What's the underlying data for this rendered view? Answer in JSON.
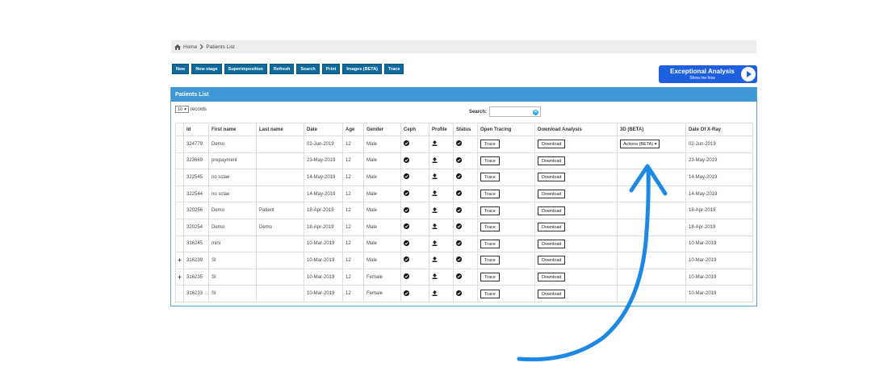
{
  "breadcrumb": {
    "home": "Home",
    "current": "Patients List"
  },
  "toolbar": [
    "New",
    "New stage",
    "Superimposition",
    "Refresh",
    "Search",
    "Print",
    "Images (BETA)",
    "Trace"
  ],
  "promo": {
    "title": "Exceptional Analysis",
    "subtitle": "Show me how"
  },
  "panel": {
    "title": "Patients List"
  },
  "controls": {
    "page_length": "10",
    "records_label": "records",
    "search_label": "Search:"
  },
  "columns": [
    "Id",
    "First name",
    "Last name",
    "Date",
    "Age",
    "Gender",
    "Ceph",
    "Profile",
    "Status",
    "Open Tracing",
    "Download Analysis",
    "3D (BETA)",
    "Date Of X-Ray"
  ],
  "buttons": {
    "trace": "Trace",
    "download": "Download",
    "actions": "Actions (BETA)"
  },
  "rows": [
    {
      "expand": "",
      "id": "324779",
      "first": "Demo",
      "last": "",
      "date": "02-Jun-2019",
      "age": "12",
      "gender": "Male",
      "xray": "02-Jun-2019"
    },
    {
      "expand": "",
      "id": "323669",
      "first": "prepayment",
      "last": "",
      "date": "23-May-2019",
      "age": "12",
      "gender": "Male",
      "xray": "23-May-2019"
    },
    {
      "expand": "",
      "id": "322545",
      "first": "no sclae",
      "last": "",
      "date": "14-May-2019",
      "age": "12",
      "gender": "Male",
      "xray": "14-May-2019"
    },
    {
      "expand": "",
      "id": "322544",
      "first": "no sclae",
      "last": "",
      "date": "14-May-2019",
      "age": "12",
      "gender": "Male",
      "xray": "14-May-2019"
    },
    {
      "expand": "",
      "id": "320256",
      "first": "Demo",
      "last": "Patient",
      "date": "18-Apr-2019",
      "age": "12",
      "gender": "Male",
      "xray": "18-Apr-2019"
    },
    {
      "expand": "",
      "id": "320254",
      "first": "Demo",
      "last": "Demo",
      "date": "18-Apr-2019",
      "age": "12",
      "gender": "Male",
      "xray": "18-Apr-2019"
    },
    {
      "expand": "",
      "id": "316245",
      "first": "mini",
      "last": "",
      "date": "10-Mar-2019",
      "age": "12",
      "gender": "Male",
      "xray": "10-Mar-2019"
    },
    {
      "expand": "+",
      "id": "316239",
      "first": "SI",
      "last": "",
      "date": "10-Mar-2019",
      "age": "12",
      "gender": "Male",
      "xray": "10-Mar-2019"
    },
    {
      "expand": "+",
      "id": "316235",
      "first": "SI",
      "last": "",
      "date": "10-Mar-2019",
      "age": "12",
      "gender": "Female",
      "xray": "10-Mar-2019"
    },
    {
      "expand": "",
      "id": "316233",
      "first": "SI",
      "last": "",
      "date": "10-Mar-2019",
      "age": "12",
      "gender": "Female",
      "xray": "10-Mar-2019"
    }
  ],
  "colors": {
    "toolbar_button": "#0e6a9c",
    "panel_header": "#3f97d6",
    "promo": "#1e5fe0",
    "annotation_arrow": "#1e88e5"
  },
  "icons": {
    "ceph": "check-circle-icon",
    "profile": "upload-icon",
    "status": "check-circle-icon"
  }
}
